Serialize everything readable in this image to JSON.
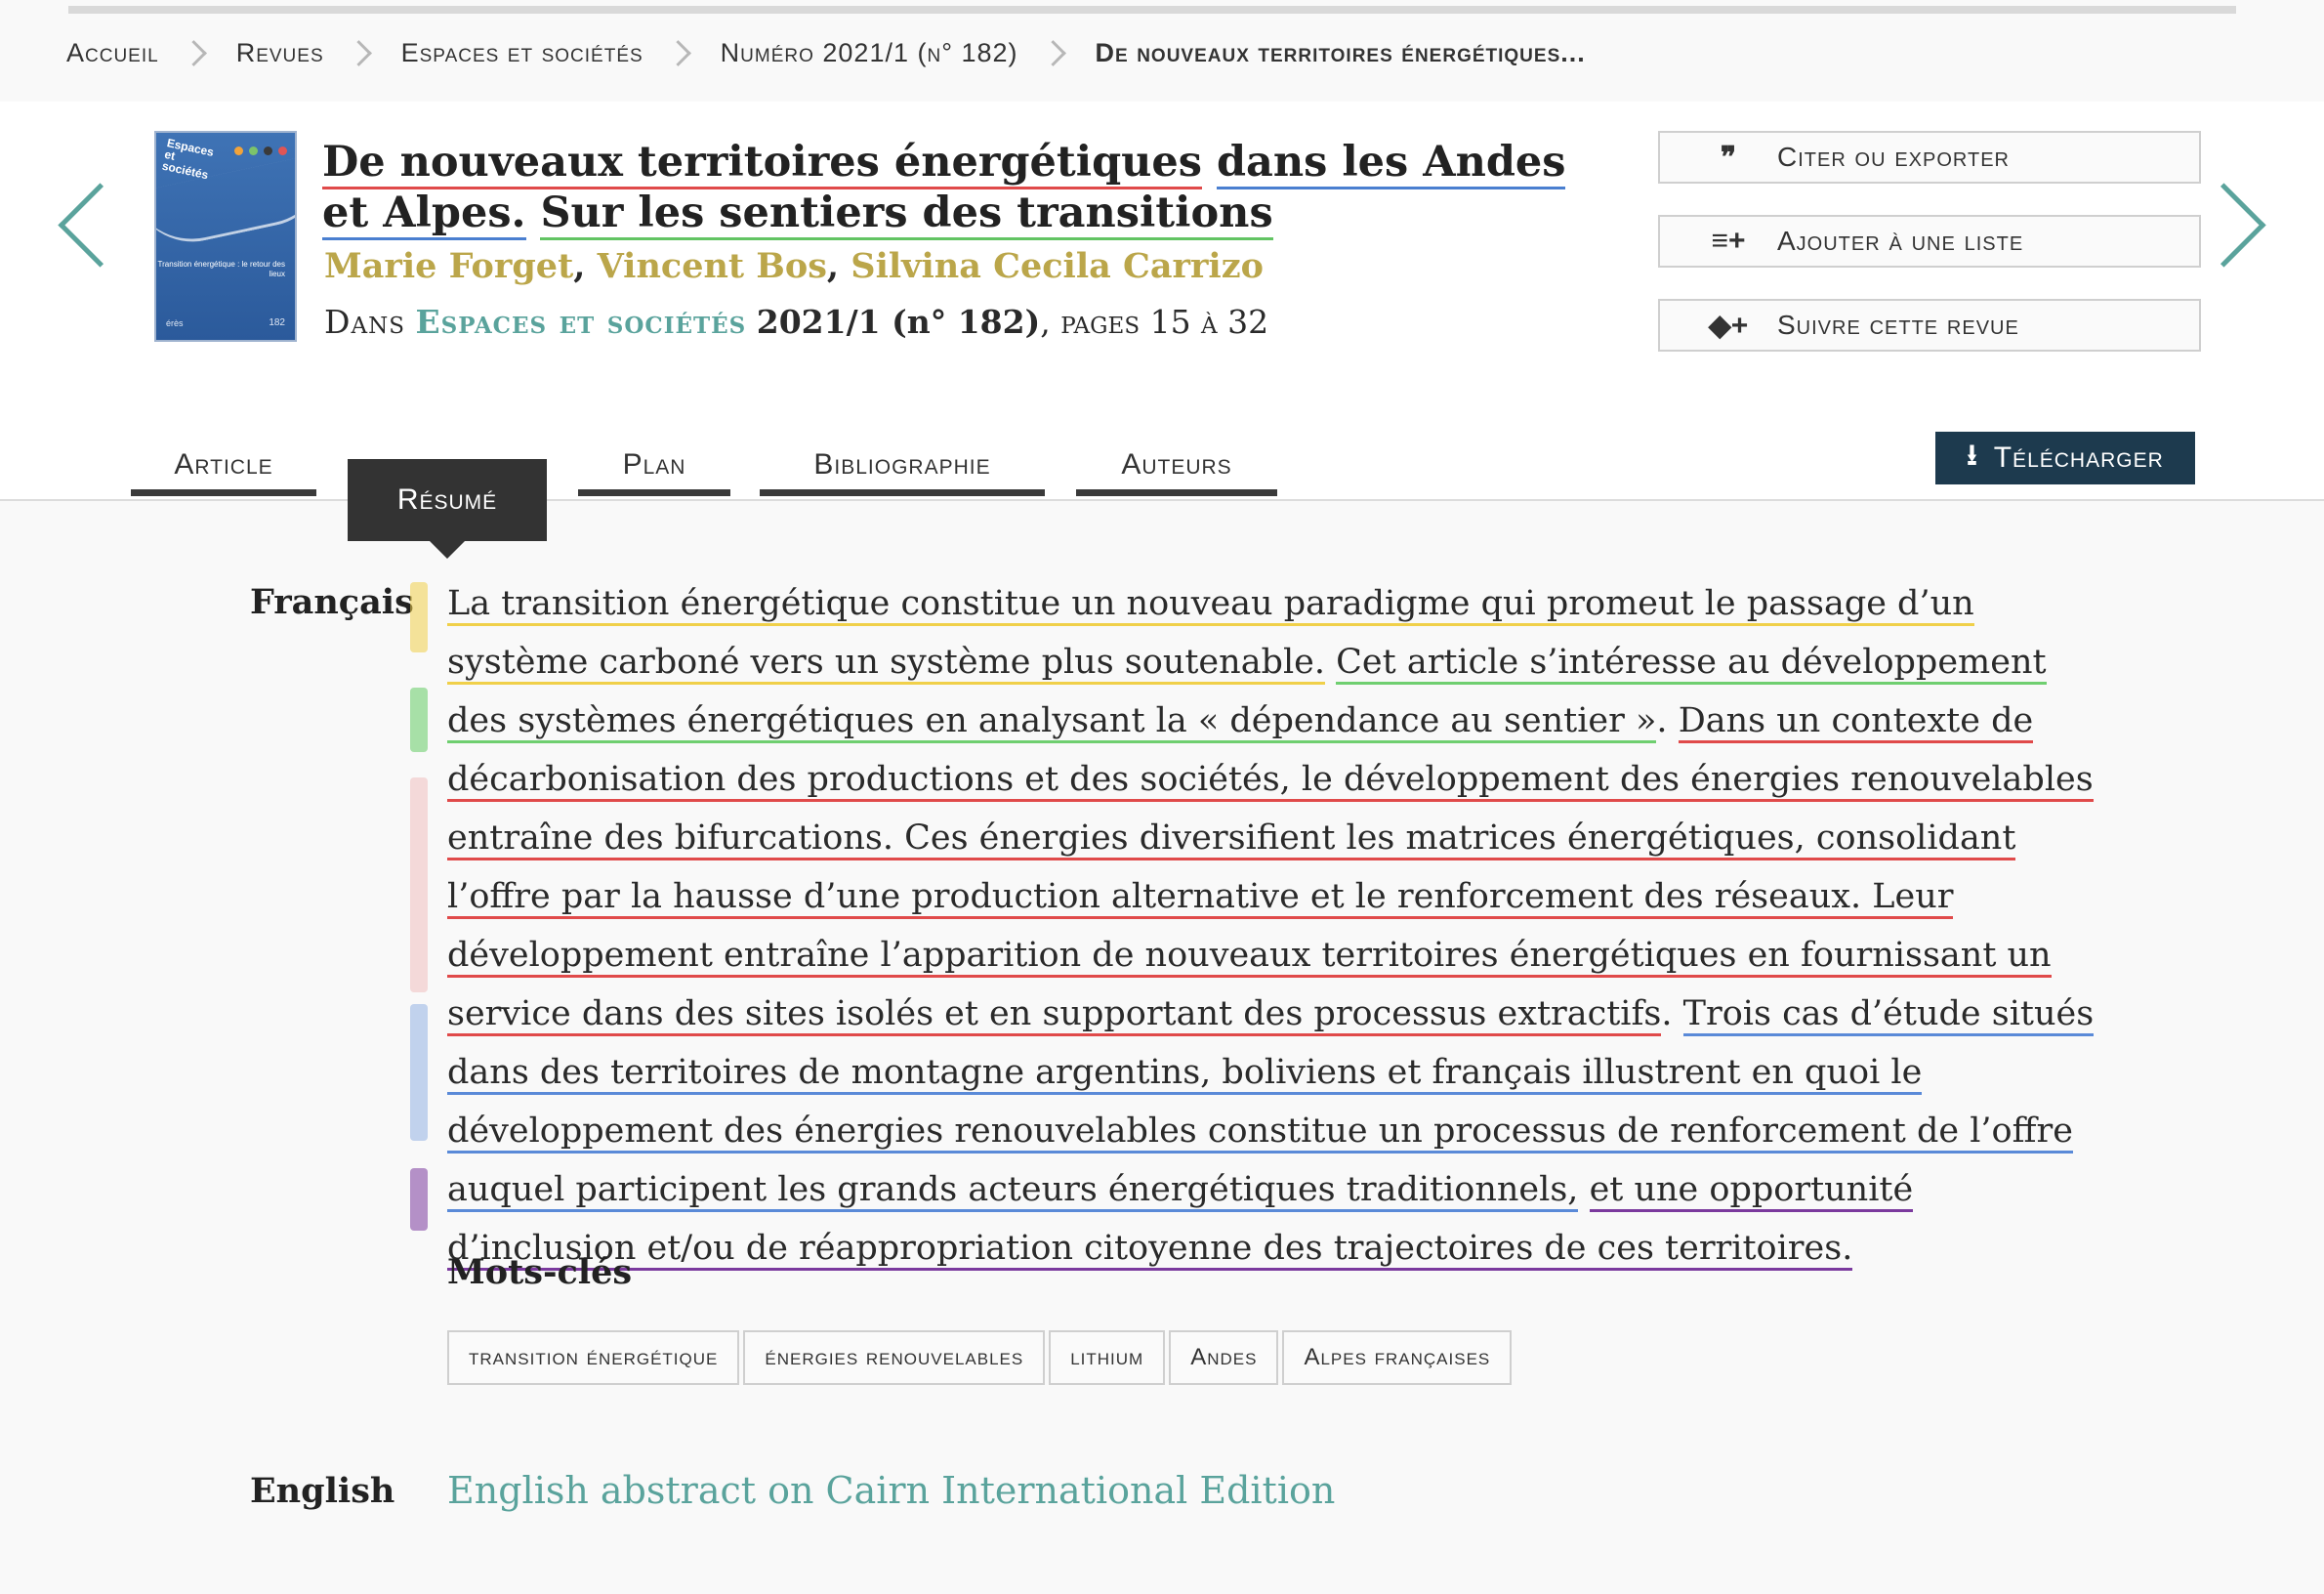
{
  "breadcrumb": {
    "items": [
      "Accueil",
      "Revues",
      "Espaces et sociétés",
      "Numéro 2021/1 (n° 182)",
      "De nouveaux territoires énergétiques..."
    ]
  },
  "cover": {
    "title": "Espaces et sociétés",
    "subtitle": "Transition énergétique : le retour des lieux",
    "publisher": "érès",
    "number": "182"
  },
  "article": {
    "title_part1": "De nouveaux territoires énergétiques",
    "title_part2": "dans les Andes et Alpes.",
    "title_part3": "Sur les sentiers des transitions",
    "authors": [
      "Marie Forget",
      "Vincent Bos",
      "Silvina Cecila Carrizo"
    ],
    "in_label": "Dans",
    "journal": "Espaces et sociétés",
    "issue": "2021/1 (n° 182)",
    "pages": "pages 15 à 32"
  },
  "actions": {
    "cite": "Citer ou exporter",
    "add_list": "Ajouter à une liste",
    "follow": "Suivre cette revue"
  },
  "tabs": [
    "Article",
    "Résumé",
    "Plan",
    "Bibliographie",
    "Auteurs"
  ],
  "download": "Télécharger",
  "abstract": {
    "lang": "Français",
    "s1": "La transition énergétique constitue un nouveau paradigme qui promeut le passage d’un système carboné vers un système plus soutenable.",
    "s2": "Cet article s’intéresse au développement des systèmes énergétiques en analysant la « dépendance au sentier »",
    "s3": "Dans un contexte de décarbonisation des productions et des sociétés, le développement des énergies renouvelables entraîne des bifurcations. Ces énergies diversifient les matrices énergétiques, consolidant l’offre par la hausse d’une production alternative et le renforcement des réseaux. Leur développement entraîne l’apparition de nouveaux territoires énergétiques en fournissant un service dans des sites isolés et en supportant des processus extractifs",
    "s4": "Trois cas d’étude situés dans des territoires de montagne argentins, boliviens et français illustrent en quoi le développement des énergies renouvelables constitue un processus de renforcement de l’offre auquel participent les grands acteurs énergétiques traditionnels,",
    "s5": "et une opportunité d’inclusion et/ou de réappropriation citoyenne des trajectoires de ces territoires."
  },
  "keywords": {
    "title": "Mots-clés",
    "items": [
      "transition énergétique",
      "énergies renouvelables",
      "lithium",
      "Andes",
      "Alpes françaises"
    ]
  },
  "english": {
    "lang": "English",
    "link": "English abstract on Cairn International Edition"
  },
  "colors": {
    "accent": "#5aa39c",
    "author": "#bba64a",
    "download_bg": "#1d3a4e",
    "highlight_yellow": "#f0d04a",
    "highlight_green": "#6fcf70",
    "highlight_red": "#e04a4a",
    "highlight_blue": "#5a8ad8",
    "highlight_purple": "#7b3a9e"
  }
}
